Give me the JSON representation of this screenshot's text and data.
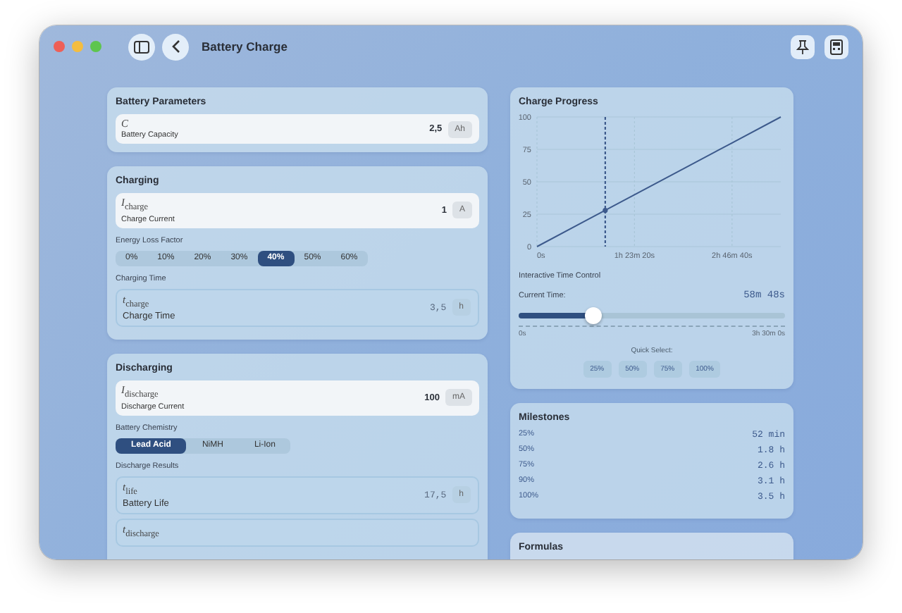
{
  "window": {
    "title": "Battery Charge"
  },
  "battery_parameters": {
    "title": "Battery Parameters",
    "inputs": [
      {
        "symbol": "*C*",
        "label": "Battery Capacity",
        "value": "2,5",
        "unit": "Ah"
      }
    ]
  },
  "charging": {
    "title": "Charging",
    "inputs": [
      {
        "symbol": "*I*$_{charge}$",
        "label": "Charge Current",
        "value": "1",
        "unit": "A"
      }
    ],
    "loss_label": "Energy Loss Factor",
    "loss_options": [
      {
        "label": "0%",
        "selected": false
      },
      {
        "label": "10%",
        "selected": false
      },
      {
        "label": "20%",
        "selected": false
      },
      {
        "label": "30%",
        "selected": false
      },
      {
        "label": "40%",
        "selected": true
      },
      {
        "label": "50%",
        "selected": false
      },
      {
        "label": "60%",
        "selected": false
      }
    ],
    "results_label": "Charging Time",
    "results": [
      {
        "symbol": "*t*$_{charge}$",
        "label": "Charge Time",
        "value": "3,5",
        "unit": "h"
      }
    ]
  },
  "discharging": {
    "title": "Discharging",
    "inputs": [
      {
        "symbol": "*I*$_{discharge}$",
        "label": "Discharge Current",
        "value": "100",
        "unit": "mA"
      }
    ],
    "chemistry_label": "Battery Chemistry",
    "chemistry_options": [
      {
        "label": "Lead Acid",
        "selected": true
      },
      {
        "label": "NiMH",
        "selected": false
      },
      {
        "label": "Li-Ion",
        "selected": false
      }
    ],
    "results_label": "Discharge Results",
    "results": [
      {
        "symbol": "*t*$_{life}$",
        "label": "Battery Life",
        "value": "17,5",
        "unit": "h"
      },
      {
        "symbol": "*t*$_{discharge}$"
      }
    ]
  },
  "charge_progress": {
    "title": "Charge Progress",
    "chart_data": {
      "type": "line",
      "categories": [
        "0s",
        null,
        "1h 23m 20s",
        null,
        "2h 46m 40s",
        null
      ],
      "values": [
        0,
        20,
        40,
        60,
        80,
        100
      ],
      "ylim": [
        0,
        100
      ],
      "grid": true,
      "yticks": [
        0,
        25,
        50,
        75,
        100
      ]
    },
    "control_title": "Interactive Time Control",
    "current_label": "Current Time:",
    "current_value": "58m 48s",
    "level": 0.28,
    "min_label": "0s",
    "max_label": "3h 30m 0s",
    "quick_label": "Quick Select:",
    "quick_options": [
      {
        "label": "25%",
        "selected": false
      },
      {
        "label": "50%",
        "selected": false
      },
      {
        "label": "75%",
        "selected": false
      },
      {
        "label": "100%",
        "selected": false
      }
    ]
  },
  "milestones": {
    "title": "Milestones",
    "rows": [
      {
        "label": "25%",
        "value": "52 min"
      },
      {
        "label": "50%",
        "value": "1.8 h"
      },
      {
        "label": "75%",
        "value": "2.6 h"
      },
      {
        "label": "90%",
        "value": "3.1 h"
      },
      {
        "label": "100%",
        "value": "3.5 h"
      }
    ]
  },
  "formulas": {
    "title": "Formulas"
  }
}
